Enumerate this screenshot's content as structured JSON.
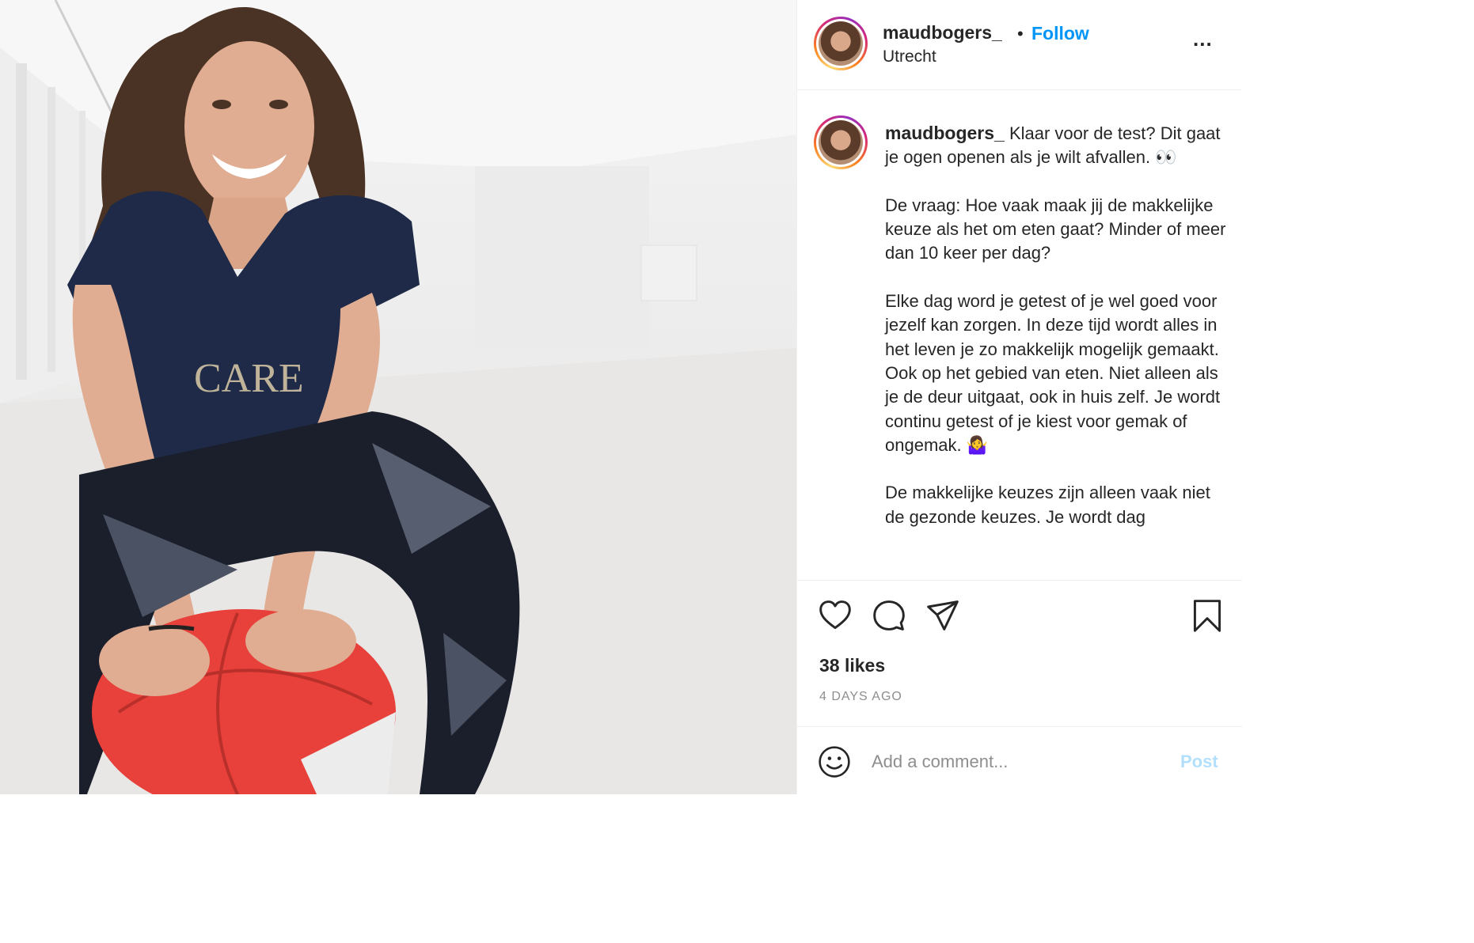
{
  "post": {
    "username": "maudbogers_",
    "separator": "•",
    "follow_label": "Follow",
    "location": "Utrecht",
    "more_label": "...",
    "caption_text": " Klaar voor de test? Dit gaat je ogen openen als je wilt afvallen. 👀\n\nDe vraag: Hoe vaak maak jij de makkelijke keuze als het om eten gaat? Minder of meer dan 10 keer per dag?\n\nElke dag word je getest of je wel goed voor jezelf kan zorgen. In deze tijd wordt alles in het leven je zo makkelijk mogelijk gemaakt. Ook op het gebied van eten. Niet alleen als je de deur uitgaat, ook in huis zelf. Je wordt continu getest of je kiest voor gemak of ongemak. 🤷‍♀️\n\nDe makkelijke keuzes zijn alleen vaak niet de gezonde keuzes. Je wordt dag",
    "likes": "38 likes",
    "time_ago": "4 DAYS AGO",
    "comment_placeholder": "Add a comment...",
    "post_label": "Post",
    "photo_shirt_text": "CARE",
    "icons": {
      "like": "heart-icon",
      "comment": "comment-bubble-icon",
      "share": "paper-plane-icon",
      "save": "bookmark-icon",
      "emoji": "smiley-icon"
    },
    "colors": {
      "follow": "#0095f6",
      "post_disabled": "#b2dffc",
      "muted": "#8e8e8e",
      "ball_red": "#e8403a"
    }
  }
}
